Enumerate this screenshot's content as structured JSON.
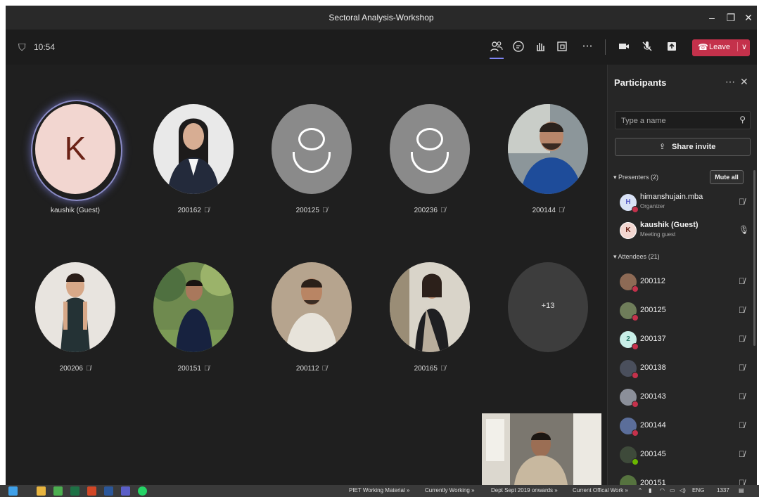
{
  "window": {
    "title": "Sectoral Analysis-Workshop",
    "minimize_icon": "minimize-icon",
    "maximize_icon": "maximize-icon",
    "close_icon": "close-icon"
  },
  "meeting_toolbar": {
    "timer": "10:54",
    "leave_label": "Leave",
    "leave_color": "#c4314b",
    "accent": "#7f85f5",
    "icons": [
      "shield-icon",
      "people-icon",
      "chat-icon",
      "raise-hand-icon",
      "rooms-icon",
      "more-icon",
      "camera-icon",
      "mic-off-icon",
      "share-tray-icon",
      "phone-icon",
      "chevron-down-icon"
    ]
  },
  "stage": {
    "tiles": [
      {
        "name": "kaushik (Guest)",
        "type": "initial",
        "initial": "K",
        "active": true
      },
      {
        "name": "200162",
        "type": "photo",
        "photo": "woman-blazer"
      },
      {
        "name": "200125",
        "type": "placeholder"
      },
      {
        "name": "200236",
        "type": "placeholder"
      },
      {
        "name": "200144",
        "type": "photo",
        "photo": "man-blue-jacket"
      },
      {
        "name": "200206",
        "type": "photo",
        "photo": "woman-dress"
      },
      {
        "name": "200151",
        "type": "photo",
        "photo": "man-trees"
      },
      {
        "name": "200112",
        "type": "photo",
        "photo": "man-white-shirt"
      },
      {
        "name": "200165",
        "type": "photo",
        "photo": "woman-saree"
      },
      {
        "name": "",
        "type": "more",
        "label": "+13"
      }
    ],
    "self_view": "self-view-video"
  },
  "participants_panel": {
    "title": "Participants",
    "search_placeholder": "Type a name",
    "share_invite_label": "Share invite",
    "presenters_header": "Presenters (2)",
    "mute_all_label": "Mute all",
    "attendees_header": "Attendees (21)",
    "presenters": [
      {
        "name": "himanshujain.mba",
        "role": "Organizer",
        "initial": "H"
      },
      {
        "name": "kaushik (Guest)",
        "role": "Meeting guest",
        "initial": "K"
      }
    ],
    "attendees": [
      {
        "name": "200112"
      },
      {
        "name": "200125"
      },
      {
        "name": "200137",
        "initial": "2"
      },
      {
        "name": "200138"
      },
      {
        "name": "200143"
      },
      {
        "name": "200144"
      },
      {
        "name": "200145"
      },
      {
        "name": "200151"
      }
    ]
  },
  "taskbar": {
    "links": [
      "PIET Working Material",
      "Currently Working",
      "Dept Sept 2019 onwards",
      "Current Offical Work"
    ],
    "language": "ENG",
    "time": "1337"
  }
}
